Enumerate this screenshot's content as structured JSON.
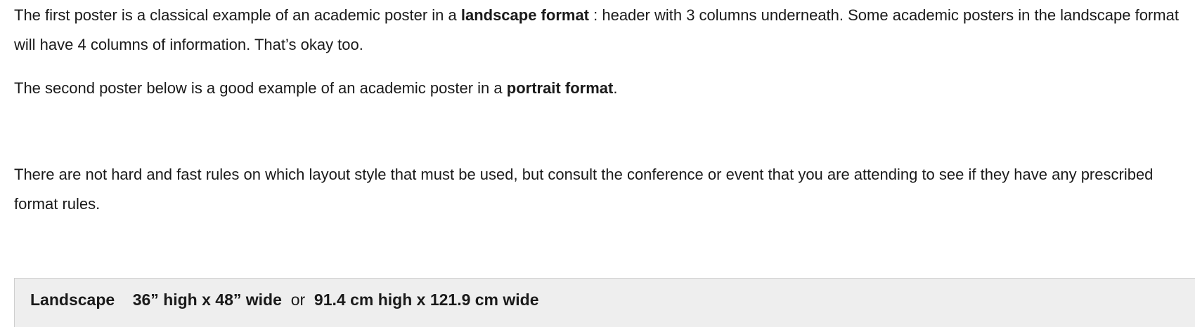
{
  "paragraph1": {
    "text_before": "The first poster is a classical example of an academic poster in a ",
    "bold": "landscape format",
    "text_after": " : header with 3 columns underneath.  Some academic posters in the landscape format will have 4 columns of information.  That’s okay too."
  },
  "paragraph2": {
    "text_before": "The second poster below is a good example of an academic poster in a ",
    "bold": "portrait format",
    "text_after": "."
  },
  "paragraph3": {
    "text": "There are not hard and fast rules on which layout style that must be used, but consult the conference or event that you are attending to see if they have any prescribed format rules."
  },
  "spec": {
    "label": "Landscape",
    "imperial": "36” high x 48” wide",
    "or": "or",
    "metric": "91.4 cm high x 121.9 cm wide"
  }
}
